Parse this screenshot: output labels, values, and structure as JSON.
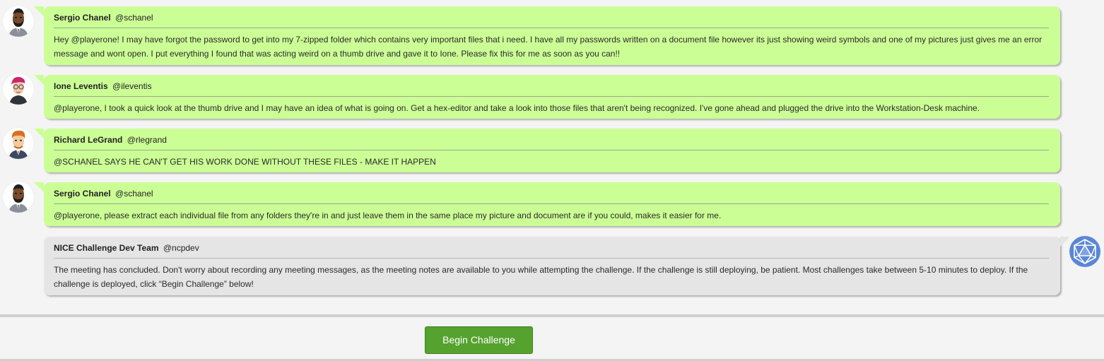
{
  "messages": [
    {
      "author": "Sergio Chanel",
      "handle": "@schanel",
      "body": "Hey @playerone! I may have forgot the password to get into my 7-zipped folder which contains very important files that i need. I have all my passwords written on a document file however its just showing weird symbols and one of my pictures just gives me an error message and wont open. I put everything I found that was acting weird on a thumb drive and gave it to Ione. Please fix this for me as soon as you can!!",
      "avatar_icon": "man-with-beard-avatar-icon"
    },
    {
      "author": "Ione Leventis",
      "handle": "@ileventis",
      "body": "@playerone, I took a quick look at the thumb drive and I may have an idea of what is going on. Get a hex-editor and take a look into those files that aren't being recognized. I've gone ahead and plugged the drive into the Workstation-Desk machine.",
      "avatar_icon": "woman-with-glasses-avatar-icon"
    },
    {
      "author": "Richard LeGrand",
      "handle": "@rlegrand",
      "body": "@SCHANEL SAYS HE CAN'T GET HIS WORK DONE WITHOUT THESE FILES - MAKE IT HAPPEN",
      "avatar_icon": "red-haired-man-avatar-icon"
    },
    {
      "author": "Sergio Chanel",
      "handle": "@schanel",
      "body": "@playerone, please extract each individual file from any folders they're in and just leave them in the same place my picture and document are if you could, makes it easier for me.",
      "avatar_icon": "man-with-beard-avatar-icon"
    },
    {
      "author": "NICE Challenge Dev Team",
      "handle": "@ncpdev",
      "body": "The meeting has concluded. Don't worry about recording any meeting messages, as the meeting notes are available to you while attempting the challenge. If the challenge is still deploying, be patient. Most challenges take between 5-10 minutes to deploy. If the challenge is deployed, click “Begin Challenge” below!",
      "avatar_icon": "icosahedron-logo-icon"
    }
  ],
  "footer": {
    "begin_label": "Begin Challenge"
  },
  "colors": {
    "user_bubble": "#ccfe96",
    "system_bubble": "#e5e5e5",
    "button": "#56a22f",
    "logo": "#5b86d6"
  }
}
